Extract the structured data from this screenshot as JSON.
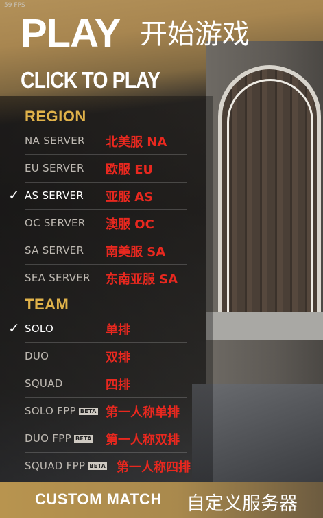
{
  "fps": "59 FPS",
  "header": {
    "title": "PLAY",
    "title_cn": "开始游戏",
    "subtitle": "CLICK TO PLAY"
  },
  "region": {
    "title": "REGION",
    "items": [
      {
        "label": "NA SERVER",
        "cn": "北美服 NA",
        "selected": false
      },
      {
        "label": "EU SERVER",
        "cn": "欧服 EU",
        "selected": false
      },
      {
        "label": "AS SERVER",
        "cn": "亚服 AS",
        "selected": true
      },
      {
        "label": "OC SERVER",
        "cn": "澳服 OC",
        "selected": false
      },
      {
        "label": "SA SERVER",
        "cn": "南美服 SA",
        "selected": false
      },
      {
        "label": "SEA SERVER",
        "cn": "东南亚服 SA",
        "selected": false
      }
    ]
  },
  "team": {
    "title": "TEAM",
    "items": [
      {
        "label": "SOLO",
        "cn": "单排",
        "selected": true,
        "beta": ""
      },
      {
        "label": "DUO",
        "cn": "双排",
        "selected": false,
        "beta": ""
      },
      {
        "label": "SQUAD",
        "cn": "四排",
        "selected": false,
        "beta": ""
      },
      {
        "label": "SOLO FPP",
        "cn": "第一人称单排",
        "selected": false,
        "beta": "BETA"
      },
      {
        "label": "DUO FPP",
        "cn": "第一人称双排",
        "selected": false,
        "beta": "BETA"
      },
      {
        "label": "SQUAD FPP",
        "cn": "第一人称四排",
        "selected": false,
        "beta": "BETA"
      }
    ]
  },
  "check_glyph": "✓",
  "custom_match": {
    "label": "CUSTOM MATCH",
    "cn": "自定义服务器"
  },
  "colors": {
    "section_title": "#e0b24a",
    "annotation_red": "#e8281f",
    "custom_bar": "#b8944f"
  }
}
